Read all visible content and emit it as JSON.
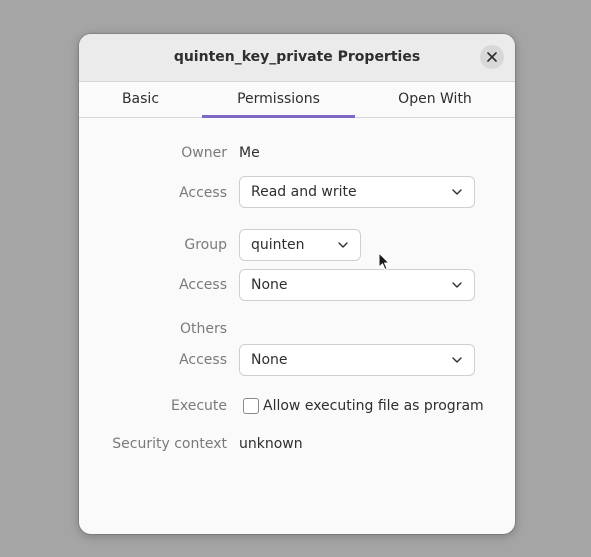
{
  "window": {
    "title": "quinten_key_private Properties"
  },
  "tabs": [
    {
      "label": "Basic",
      "active": false
    },
    {
      "label": "Permissions",
      "active": true
    },
    {
      "label": "Open With",
      "active": false
    }
  ],
  "permissions": {
    "owner_label": "Owner",
    "owner_value": "Me",
    "owner_access_label": "Access",
    "owner_access_value": "Read and write",
    "group_label": "Group",
    "group_value": "quinten",
    "group_access_label": "Access",
    "group_access_value": "None",
    "others_label": "Others",
    "others_access_label": "Access",
    "others_access_value": "None",
    "execute_label": "Execute",
    "execute_checkbox_label": "Allow executing file as program",
    "execute_checked": false,
    "security_context_label": "Security context",
    "security_context_value": "unknown"
  },
  "colors": {
    "accent": "#7e67c2",
    "background": "#a5a5a5",
    "dialog": "#fafafa",
    "titlebar": "#ebebeb"
  },
  "icons": {
    "close": "close-icon",
    "dropdown": "chevron-down-icon",
    "cursor": "mouse-pointer-icon"
  }
}
